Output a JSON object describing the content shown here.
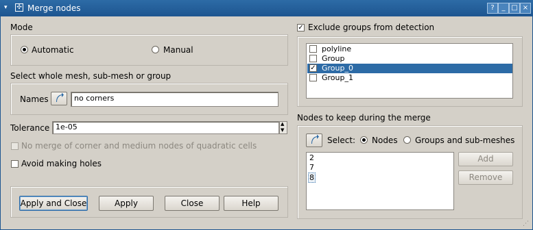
{
  "window": {
    "title": "Merge nodes",
    "buttons": [
      "?",
      "_",
      "□",
      "×"
    ]
  },
  "mode": {
    "label": "Mode",
    "options": [
      "Automatic",
      "Manual"
    ],
    "selected": "Automatic"
  },
  "selection": {
    "label": "Select whole mesh, sub-mesh or group",
    "names_label": "Names",
    "names_value": "no corners"
  },
  "tolerance": {
    "label": "Tolerance",
    "value": "1e-05"
  },
  "options": {
    "no_merge_corner": "No merge of corner and medium nodes of quadratic cells",
    "avoid_holes": "Avoid making holes"
  },
  "exclude": {
    "label": "Exclude groups from detection",
    "checked": true,
    "groups": [
      {
        "name": "polyline",
        "checked": false,
        "selected": false
      },
      {
        "name": "Group",
        "checked": false,
        "selected": false
      },
      {
        "name": "Group_0",
        "checked": true,
        "selected": true
      },
      {
        "name": "Group_1",
        "checked": false,
        "selected": false
      }
    ]
  },
  "keep": {
    "label": "Nodes to keep during the merge",
    "select_label": "Select:",
    "options": [
      "Nodes",
      "Groups and sub-meshes"
    ],
    "selected": "Nodes",
    "nodes": [
      "2",
      "7",
      "8"
    ],
    "add_label": "Add",
    "remove_label": "Remove"
  },
  "footer": {
    "apply_close": "Apply and Close",
    "apply": "Apply",
    "close": "Close",
    "help": "Help"
  },
  "colors": {
    "titlebar": "#2d6ba6",
    "selection": "#2d6ba6",
    "background": "#d4d0c8"
  }
}
